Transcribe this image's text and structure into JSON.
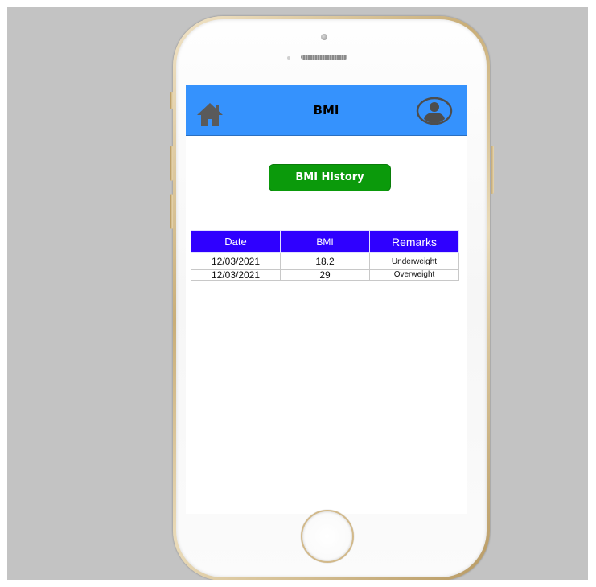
{
  "app": {
    "header_title": "BMI",
    "header_color": "#3592fd",
    "home_icon": "home-icon",
    "profile_icon": "user-circle-icon"
  },
  "actions": {
    "history_button_label": "BMI History",
    "history_button_color": "#0b9a0b"
  },
  "history_table": {
    "header_color": "#2f00ff",
    "columns": [
      "Date",
      "BMI",
      "Remarks"
    ],
    "rows": [
      [
        "12/03/2021",
        "18.2",
        "Underweight"
      ],
      [
        "12/03/2021",
        "29",
        "Overweight"
      ]
    ]
  }
}
